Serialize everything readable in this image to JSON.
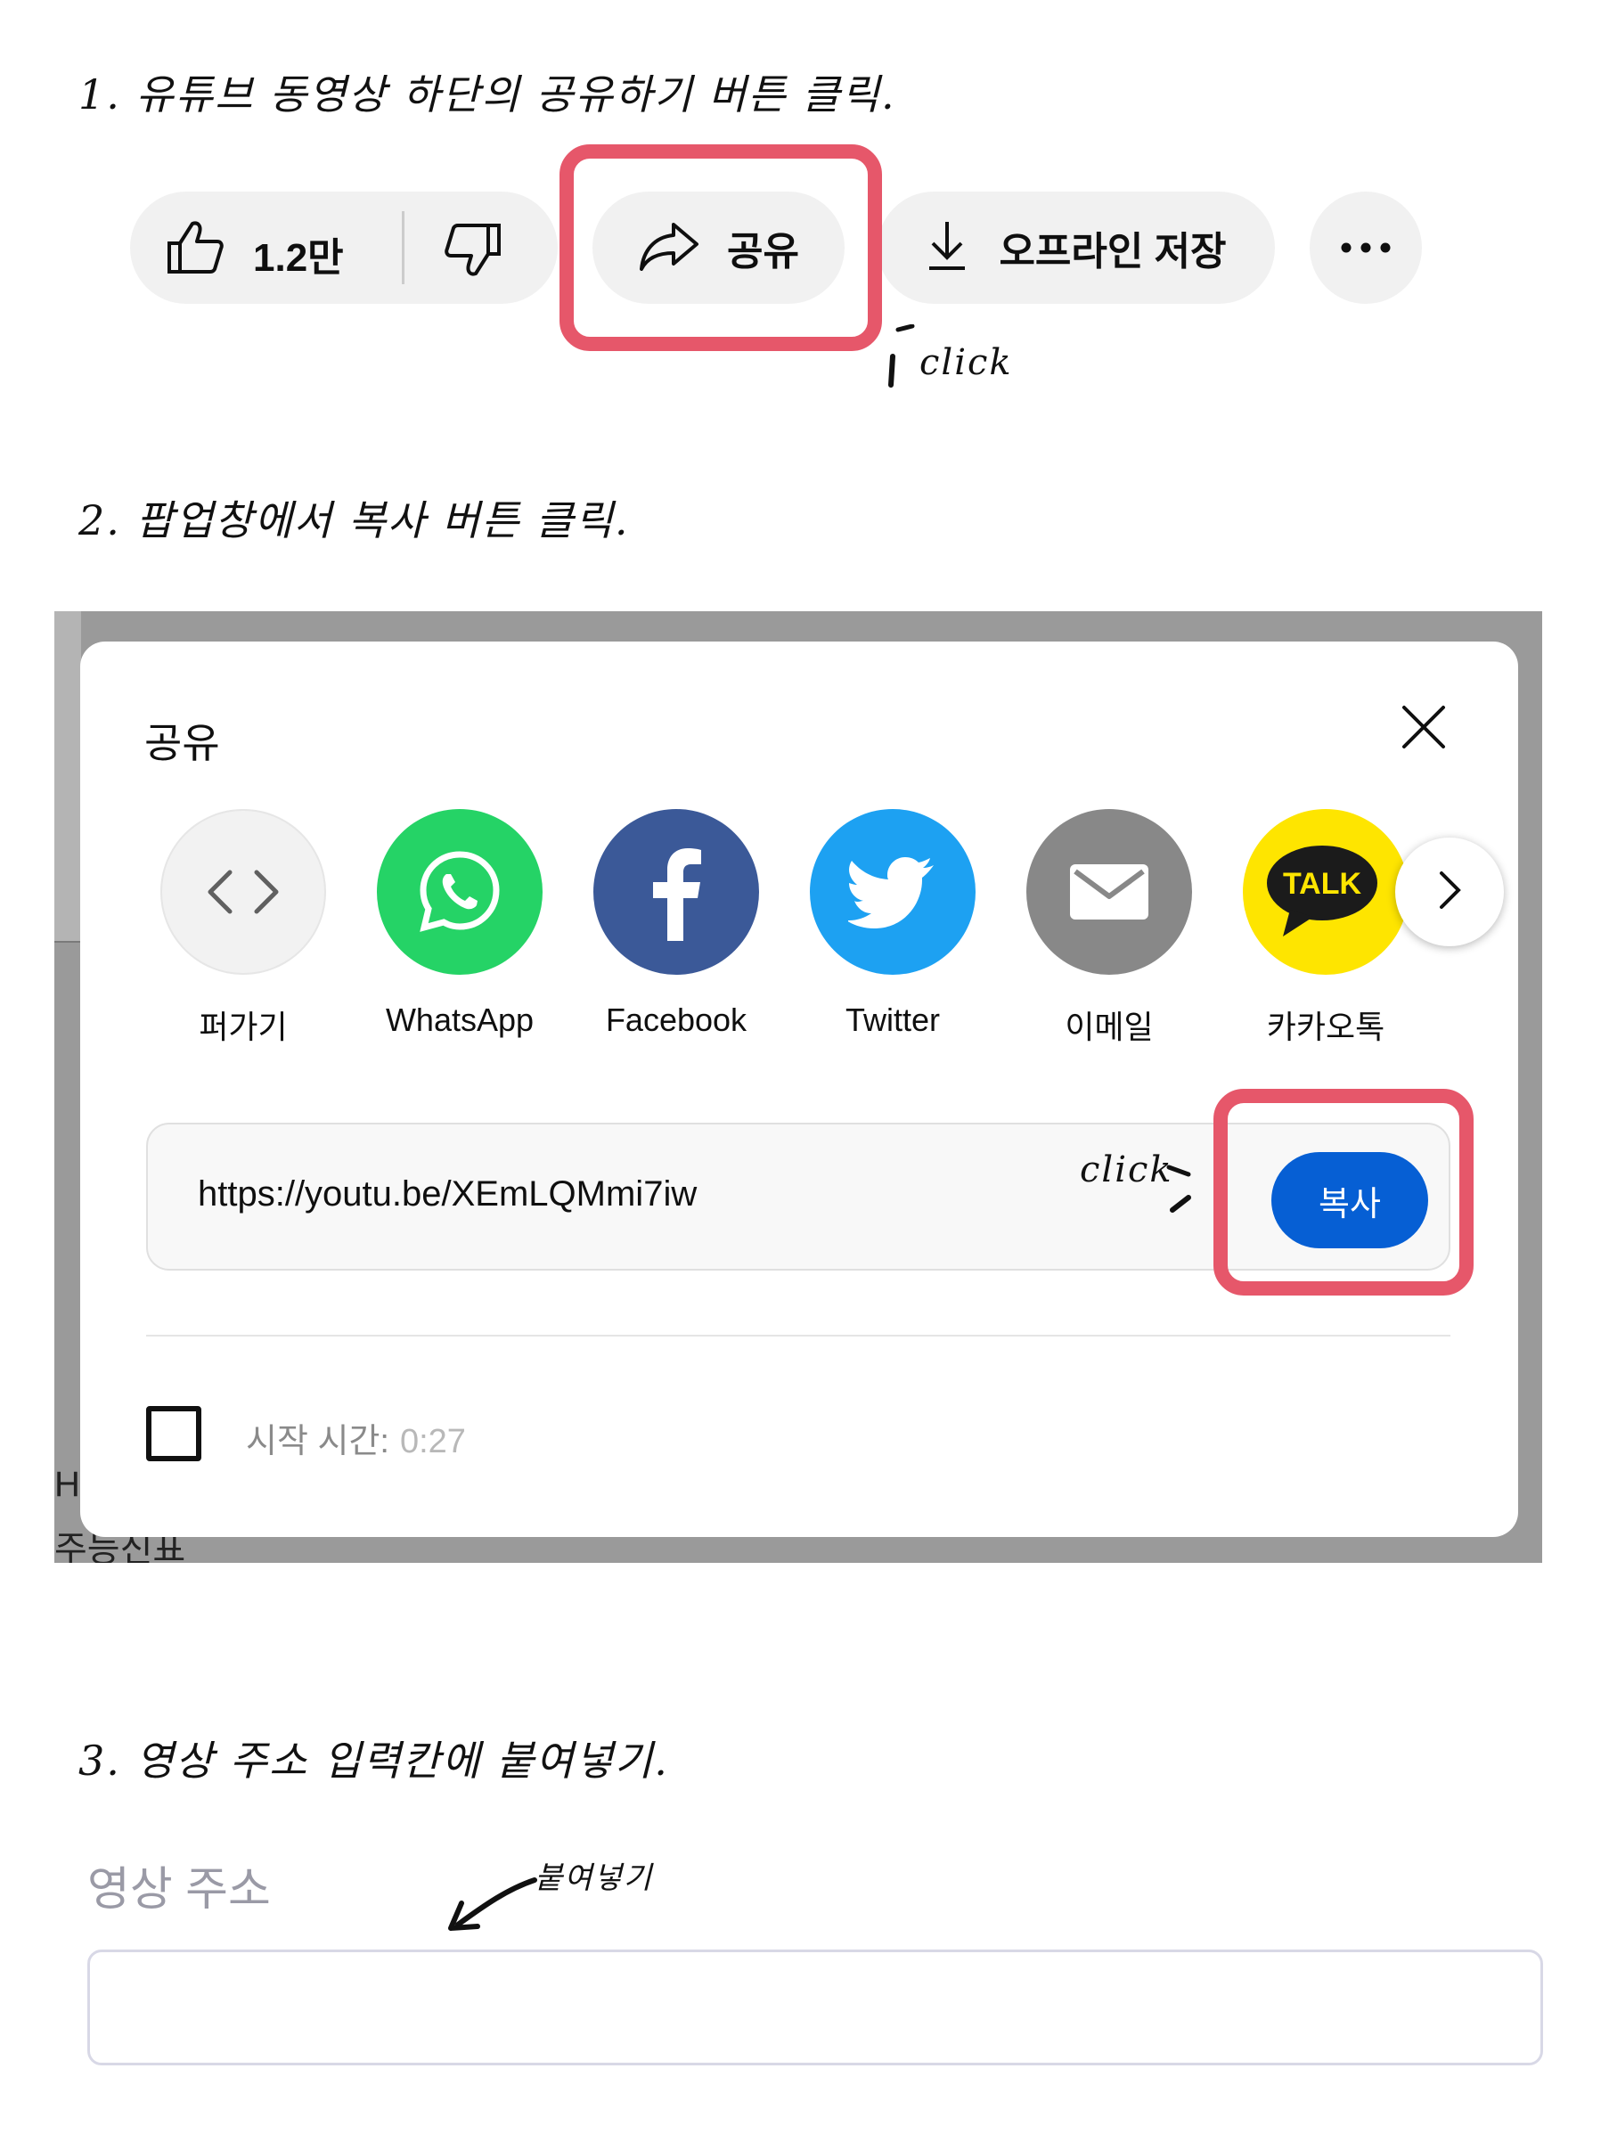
{
  "steps": {
    "step1": "1. 유튜브 동영상 하단의 공유하기 버튼 클릭.",
    "step2": "2. 팝업창에서 복사 버튼 클릭.",
    "step3": "3. 영상 주소 입력칸에 붙여넣기."
  },
  "annotations": {
    "click1": "click",
    "click2": "click",
    "paste": "붙여넣기"
  },
  "action_bar": {
    "like_count": "1.2만",
    "share_label": "공유",
    "download_label": "오프라인 저장"
  },
  "share_dialog": {
    "title": "공유",
    "targets": [
      {
        "label": "퍼가기",
        "icon": "embed-icon",
        "color": "#f2f2f2"
      },
      {
        "label": "WhatsApp",
        "icon": "whatsapp-icon",
        "color": "#25d366"
      },
      {
        "label": "Facebook",
        "icon": "facebook-icon",
        "color": "#3b5998"
      },
      {
        "label": "Twitter",
        "icon": "twitter-icon",
        "color": "#1da1f2"
      },
      {
        "label": "이메일",
        "icon": "email-icon",
        "color": "#888888"
      },
      {
        "label": "카카오톡",
        "icon": "kakaotalk-icon",
        "color": "#fee500"
      }
    ],
    "kakao_badge": "TALK",
    "url": "https://youtu.be/XEmLQMmi7iw",
    "copy_label": "복사",
    "start_time_label": "시작 시간:",
    "start_time_value": "0:27"
  },
  "background_fragments": {
    "line1": "H",
    "line2": "주능신표"
  },
  "video_address": {
    "label": "영상 주소",
    "value": ""
  },
  "colors": {
    "highlight": "#e6576a",
    "copy_button": "#065fd4"
  }
}
